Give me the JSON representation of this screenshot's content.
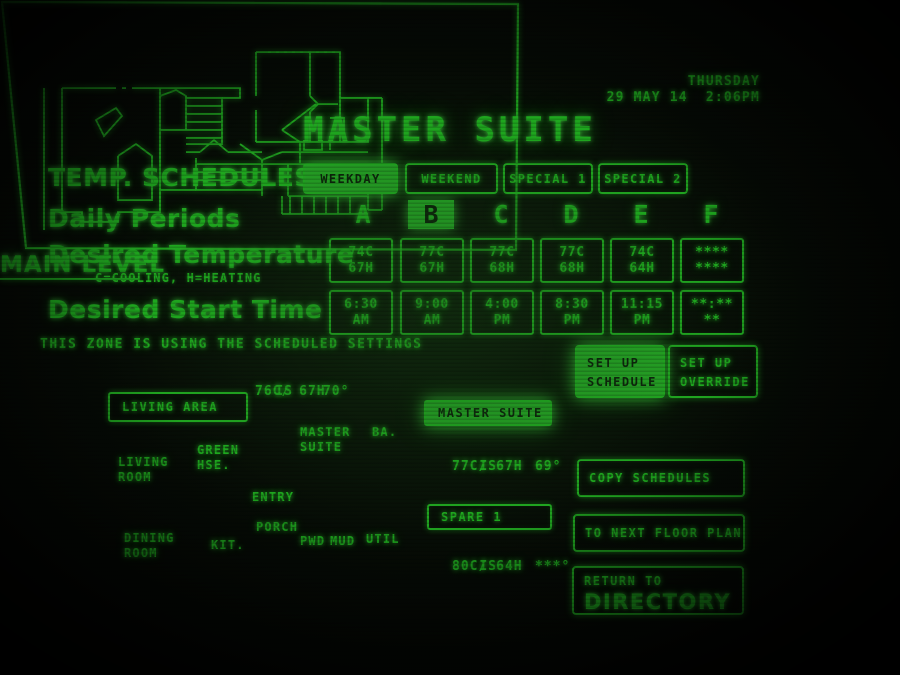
{
  "header": {
    "day_of_week": "THURSDAY",
    "date": "29 MAY 14",
    "time": "2:06PM",
    "title": "MASTER SUITE"
  },
  "labels": {
    "temp_schedules": "TEMP. SCHEDULES",
    "daily_periods": "Daily Periods",
    "desired_temperature": "Desired Temperature",
    "desired_start_time": "Desired Start Time",
    "cooling_heating_key": "C=COOLING, H=HEATING",
    "status": "THIS ZONE IS USING THE SCHEDULED SETTINGS"
  },
  "schedule_tabs": [
    {
      "label": "WEEKDAY",
      "selected": true
    },
    {
      "label": "WEEKEND",
      "selected": false
    },
    {
      "label": "SPECIAL 1",
      "selected": false
    },
    {
      "label": "SPECIAL 2",
      "selected": false
    }
  ],
  "periods": [
    {
      "letter": "A",
      "selected": false,
      "cool": "74C",
      "heat": "67H",
      "time": "6:30",
      "ampm": "AM"
    },
    {
      "letter": "B",
      "selected": true,
      "cool": "77C",
      "heat": "67H",
      "time": "9:00",
      "ampm": "AM"
    },
    {
      "letter": "C",
      "selected": false,
      "cool": "77C",
      "heat": "68H",
      "time": "4:00",
      "ampm": "PM"
    },
    {
      "letter": "D",
      "selected": false,
      "cool": "77C",
      "heat": "68H",
      "time": "8:30",
      "ampm": "PM"
    },
    {
      "letter": "E",
      "selected": false,
      "cool": "74C",
      "heat": "64H",
      "time": "11:15",
      "ampm": "PM"
    },
    {
      "letter": "F",
      "selected": false,
      "cool": "****",
      "heat": "****",
      "time": "**:**",
      "ampm": "**"
    }
  ],
  "floorplan": {
    "zone_button": "LIVING AREA",
    "zone_is_label": "IS",
    "zone_is_value": "70°",
    "zone_setpoints": "76C/ 67H",
    "rooms": [
      {
        "name": "LIVING\nROOM"
      },
      {
        "name": "GREEN\nHSE."
      },
      {
        "name": "DINING\nROOM"
      },
      {
        "name": "KIT."
      },
      {
        "name": "ENTRY"
      },
      {
        "name": "PORCH"
      },
      {
        "name": "PWD"
      },
      {
        "name": "MUD"
      },
      {
        "name": "UTIL"
      },
      {
        "name": "MASTER\nSUITE"
      },
      {
        "name": "BA."
      }
    ]
  },
  "level_panel": {
    "heading": "MAIN LEVEL",
    "zones": [
      {
        "name": "MASTER SUITE",
        "selected": true,
        "is_label": "IS",
        "is_value": "69°",
        "setpoints": "77C/ 67H"
      },
      {
        "name": "SPARE 1",
        "selected": false,
        "is_label": "IS",
        "is_value": "***°",
        "setpoints": "80C/ 64H"
      }
    ]
  },
  "commands": {
    "set_up_schedule_l1": "SET UP",
    "set_up_schedule_l2": "SCHEDULE",
    "set_up_schedule_selected": true,
    "set_up_override_l1": "SET UP",
    "set_up_override_l2": "OVERRIDE",
    "copy_schedules": "COPY SCHEDULES",
    "to_next_floor_plan": "TO NEXT FLOOR PLAN",
    "return_to": "RETURN TO",
    "directory": "DIRECTORY"
  },
  "colors": {
    "phosphor": "#2df22d",
    "phosphor_bright": "#33ea33",
    "background": "#050704",
    "inverted_text": "#0d2a0b"
  }
}
